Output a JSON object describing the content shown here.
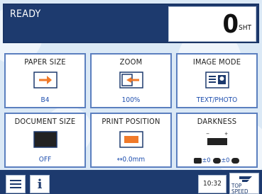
{
  "status": {
    "text": "READY"
  },
  "counter": {
    "value": "0",
    "unit": "SHT"
  },
  "tiles": [
    {
      "title": "PAPER SIZE",
      "value": "B4",
      "icon": "paper-size-icon"
    },
    {
      "title": "ZOOM",
      "value": "100%",
      "icon": "zoom-icon"
    },
    {
      "title": "IMAGE MODE",
      "value": "TEXT/PHOTO",
      "icon": "image-mode-icon"
    },
    {
      "title": "DOCUMENT SIZE",
      "value": "OFF",
      "icon": "document-size-icon"
    },
    {
      "title": "PRINT POSITION",
      "value": "↔0.0mm",
      "icon": "print-position-icon"
    },
    {
      "title": "DARKNESS",
      "value": "",
      "icon": "darkness-icon"
    }
  ],
  "darkness": {
    "scale_minus": "−",
    "scale_plus": "+",
    "levels": [
      "±0",
      "±0",
      ""
    ]
  },
  "bottom": {
    "menu_icon": "menu-icon",
    "info_label": "i",
    "clock": "10:32",
    "speed_label": "TOP SPEED"
  },
  "colors": {
    "accent": "#1d3a6e",
    "tile_border": "#5b7fbf",
    "value_text": "#1f4fae",
    "icon_orange": "#f07a2a"
  }
}
